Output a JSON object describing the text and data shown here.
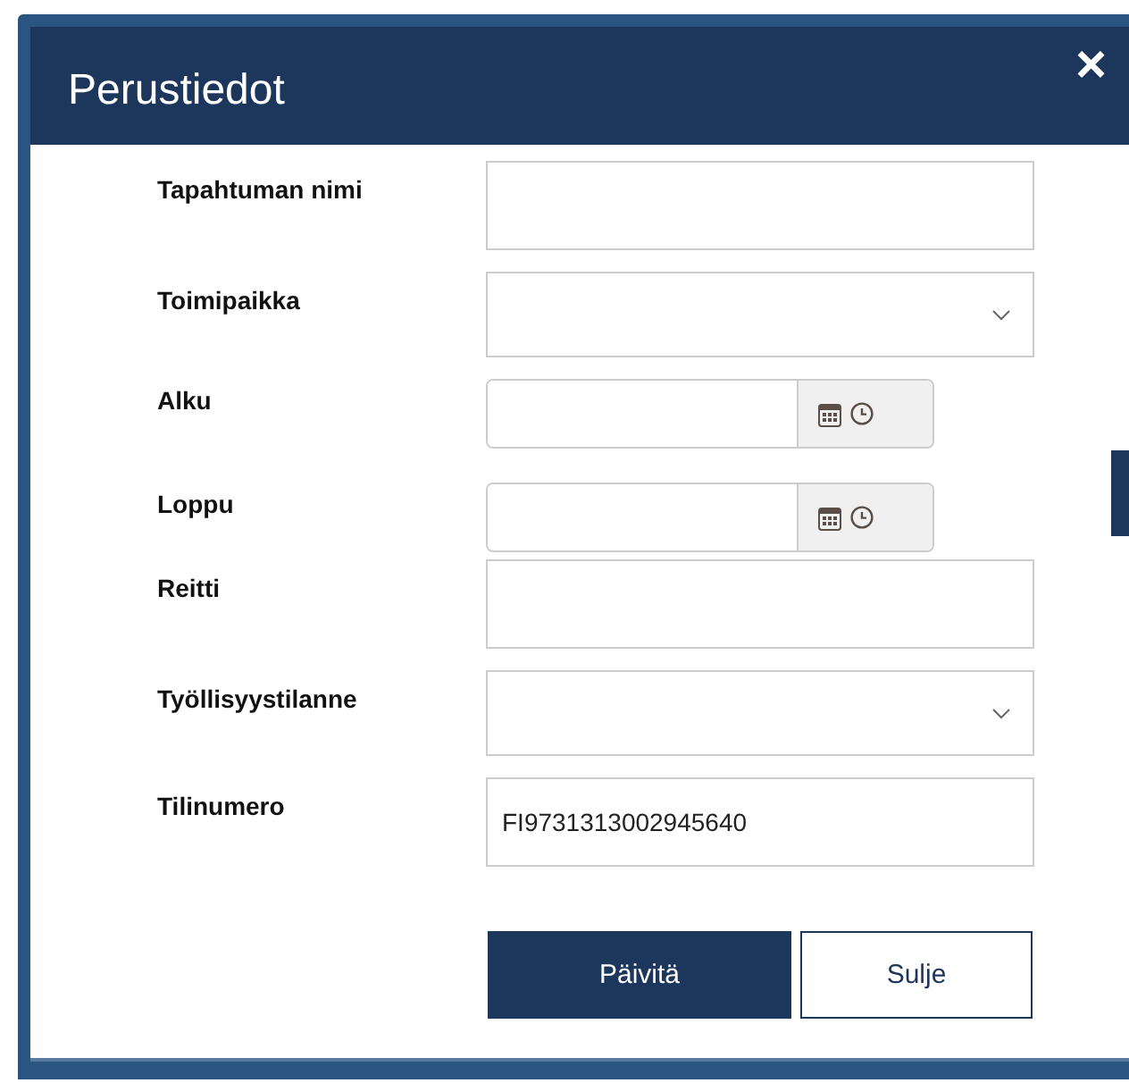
{
  "dialog": {
    "title": "Perustiedot",
    "close": "×"
  },
  "fields": [
    {
      "label": "Tapahtuman nimi",
      "kind": "text"
    },
    {
      "label": "Toimipaikka",
      "kind": "select"
    },
    {
      "label": "Alku",
      "kind": "datetime"
    },
    {
      "label": "Loppu",
      "kind": "datetime"
    },
    {
      "label": "Reitti",
      "kind": "text"
    },
    {
      "label": "Työllisyystilanne",
      "kind": "select"
    },
    {
      "label": "Tilinumero",
      "kind": "text",
      "value": "FI9731313002945640"
    }
  ],
  "buttons": [
    {
      "label": "Päivitä",
      "kind": "primary"
    },
    {
      "label": "Sulje",
      "kind": "secondary"
    }
  ]
}
